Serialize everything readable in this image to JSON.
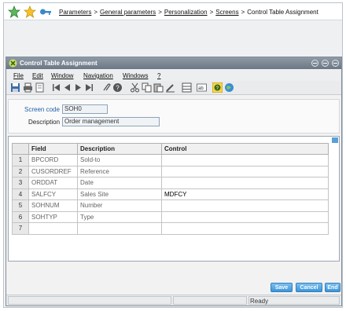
{
  "breadcrumb": {
    "items": [
      "Parameters",
      "General parameters",
      "Personalization",
      "Screens"
    ],
    "current": "Control Table Assignment"
  },
  "icons": {
    "home": "green-star-icon",
    "favorite": "yellow-star-icon",
    "key": "key-icon"
  },
  "window": {
    "title": "Control Table Assignment",
    "menu": [
      "File",
      "Edit",
      "Window",
      "Navigation",
      "Windows",
      "?"
    ]
  },
  "form": {
    "screen_code_label": "Screen code",
    "screen_code_value": "SOH0",
    "description_label": "Description",
    "description_value": "Order management"
  },
  "table": {
    "headers": [
      "Field",
      "Description",
      "Control"
    ],
    "rows": [
      {
        "num": "1",
        "field": "BPCORD",
        "description": "Sold-to",
        "control": ""
      },
      {
        "num": "2",
        "field": "CUSORDREF",
        "description": "Reference",
        "control": ""
      },
      {
        "num": "3",
        "field": "ORDDAT",
        "description": "Date",
        "control": ""
      },
      {
        "num": "4",
        "field": "SALFCY",
        "description": "Sales Site",
        "control": "MDFCY"
      },
      {
        "num": "5",
        "field": "SOHNUM",
        "description": "Number",
        "control": ""
      },
      {
        "num": "6",
        "field": "SOHTYP",
        "description": "Type",
        "control": ""
      },
      {
        "num": "7",
        "field": "",
        "description": "",
        "control": ""
      }
    ]
  },
  "buttons": {
    "save": "Save",
    "cancel": "Cancel",
    "end": "End"
  },
  "status": {
    "text": "Ready"
  },
  "colors": {
    "accent": "#3d95d6",
    "label_blue": "#1f5fa8"
  }
}
